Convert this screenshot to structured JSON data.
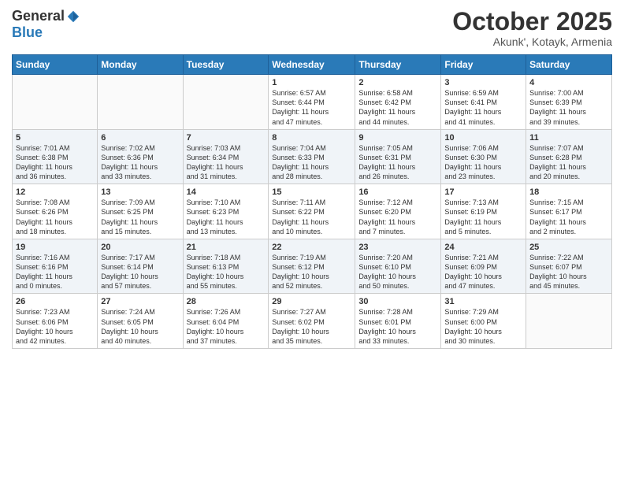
{
  "header": {
    "logo_general": "General",
    "logo_blue": "Blue",
    "month_title": "October 2025",
    "location": "Akunk', Kotayk, Armenia"
  },
  "days_of_week": [
    "Sunday",
    "Monday",
    "Tuesday",
    "Wednesday",
    "Thursday",
    "Friday",
    "Saturday"
  ],
  "weeks": [
    {
      "cells": [
        {
          "empty": true
        },
        {
          "empty": true
        },
        {
          "empty": true
        },
        {
          "day": 1,
          "sunrise": "6:57 AM",
          "sunset": "6:44 PM",
          "daylight": "11 hours and 47 minutes."
        },
        {
          "day": 2,
          "sunrise": "6:58 AM",
          "sunset": "6:42 PM",
          "daylight": "11 hours and 44 minutes."
        },
        {
          "day": 3,
          "sunrise": "6:59 AM",
          "sunset": "6:41 PM",
          "daylight": "11 hours and 41 minutes."
        },
        {
          "day": 4,
          "sunrise": "7:00 AM",
          "sunset": "6:39 PM",
          "daylight": "11 hours and 39 minutes."
        }
      ]
    },
    {
      "cells": [
        {
          "day": 5,
          "sunrise": "7:01 AM",
          "sunset": "6:38 PM",
          "daylight": "11 hours and 36 minutes."
        },
        {
          "day": 6,
          "sunrise": "7:02 AM",
          "sunset": "6:36 PM",
          "daylight": "11 hours and 33 minutes."
        },
        {
          "day": 7,
          "sunrise": "7:03 AM",
          "sunset": "6:34 PM",
          "daylight": "11 hours and 31 minutes."
        },
        {
          "day": 8,
          "sunrise": "7:04 AM",
          "sunset": "6:33 PM",
          "daylight": "11 hours and 28 minutes."
        },
        {
          "day": 9,
          "sunrise": "7:05 AM",
          "sunset": "6:31 PM",
          "daylight": "11 hours and 26 minutes."
        },
        {
          "day": 10,
          "sunrise": "7:06 AM",
          "sunset": "6:30 PM",
          "daylight": "11 hours and 23 minutes."
        },
        {
          "day": 11,
          "sunrise": "7:07 AM",
          "sunset": "6:28 PM",
          "daylight": "11 hours and 20 minutes."
        }
      ]
    },
    {
      "cells": [
        {
          "day": 12,
          "sunrise": "7:08 AM",
          "sunset": "6:26 PM",
          "daylight": "11 hours and 18 minutes."
        },
        {
          "day": 13,
          "sunrise": "7:09 AM",
          "sunset": "6:25 PM",
          "daylight": "11 hours and 15 minutes."
        },
        {
          "day": 14,
          "sunrise": "7:10 AM",
          "sunset": "6:23 PM",
          "daylight": "11 hours and 13 minutes."
        },
        {
          "day": 15,
          "sunrise": "7:11 AM",
          "sunset": "6:22 PM",
          "daylight": "11 hours and 10 minutes."
        },
        {
          "day": 16,
          "sunrise": "7:12 AM",
          "sunset": "6:20 PM",
          "daylight": "11 hours and 7 minutes."
        },
        {
          "day": 17,
          "sunrise": "7:13 AM",
          "sunset": "6:19 PM",
          "daylight": "11 hours and 5 minutes."
        },
        {
          "day": 18,
          "sunrise": "7:15 AM",
          "sunset": "6:17 PM",
          "daylight": "11 hours and 2 minutes."
        }
      ]
    },
    {
      "cells": [
        {
          "day": 19,
          "sunrise": "7:16 AM",
          "sunset": "6:16 PM",
          "daylight": "11 hours and 0 minutes."
        },
        {
          "day": 20,
          "sunrise": "7:17 AM",
          "sunset": "6:14 PM",
          "daylight": "10 hours and 57 minutes."
        },
        {
          "day": 21,
          "sunrise": "7:18 AM",
          "sunset": "6:13 PM",
          "daylight": "10 hours and 55 minutes."
        },
        {
          "day": 22,
          "sunrise": "7:19 AM",
          "sunset": "6:12 PM",
          "daylight": "10 hours and 52 minutes."
        },
        {
          "day": 23,
          "sunrise": "7:20 AM",
          "sunset": "6:10 PM",
          "daylight": "10 hours and 50 minutes."
        },
        {
          "day": 24,
          "sunrise": "7:21 AM",
          "sunset": "6:09 PM",
          "daylight": "10 hours and 47 minutes."
        },
        {
          "day": 25,
          "sunrise": "7:22 AM",
          "sunset": "6:07 PM",
          "daylight": "10 hours and 45 minutes."
        }
      ]
    },
    {
      "cells": [
        {
          "day": 26,
          "sunrise": "7:23 AM",
          "sunset": "6:06 PM",
          "daylight": "10 hours and 42 minutes."
        },
        {
          "day": 27,
          "sunrise": "7:24 AM",
          "sunset": "6:05 PM",
          "daylight": "10 hours and 40 minutes."
        },
        {
          "day": 28,
          "sunrise": "7:26 AM",
          "sunset": "6:04 PM",
          "daylight": "10 hours and 37 minutes."
        },
        {
          "day": 29,
          "sunrise": "7:27 AM",
          "sunset": "6:02 PM",
          "daylight": "10 hours and 35 minutes."
        },
        {
          "day": 30,
          "sunrise": "7:28 AM",
          "sunset": "6:01 PM",
          "daylight": "10 hours and 33 minutes."
        },
        {
          "day": 31,
          "sunrise": "7:29 AM",
          "sunset": "6:00 PM",
          "daylight": "10 hours and 30 minutes."
        },
        {
          "empty": true
        }
      ]
    }
  ]
}
